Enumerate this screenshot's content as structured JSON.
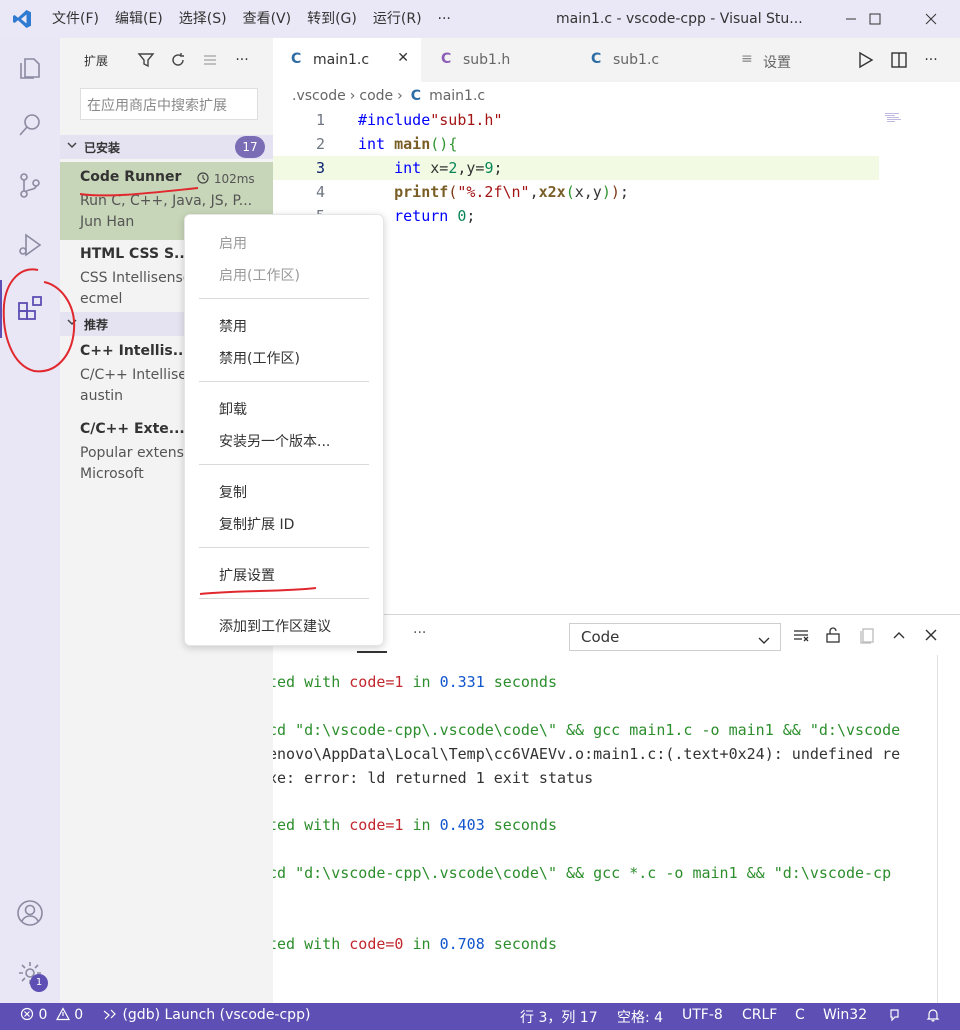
{
  "titlebar": {
    "menus": [
      "文件(F)",
      "编辑(E)",
      "选择(S)",
      "查看(V)",
      "转到(G)",
      "运行(R)",
      "···"
    ],
    "window_title": "main1.c - vscode-cpp - Visual Stu...",
    "accent": "#5d4fb3"
  },
  "activitybar": {
    "items": [
      "explorer-icon",
      "search-icon",
      "source-control-icon",
      "run-debug-icon",
      "extensions-icon"
    ],
    "accounts": "account-icon",
    "manage": "gear-icon",
    "manage_badge": "1"
  },
  "sidebar": {
    "title": "扩展",
    "search_placeholder": "在应用商店中搜索扩展",
    "installed": {
      "label": "已安装",
      "count": "17",
      "items": [
        {
          "name": "Code Runner",
          "time": "102ms",
          "desc": "Run C, C++, Java, JS, P...",
          "publisher": "Jun Han"
        },
        {
          "name": "HTML CSS S...",
          "desc": "CSS Intellisense",
          "publisher": "ecmel"
        }
      ]
    },
    "recommended": {
      "label": "推荐",
      "items": [
        {
          "name": "C++ Intellis...",
          "desc": "C/C++ Intellise",
          "publisher": "austin"
        },
        {
          "name": "C/C++ Exte...",
          "desc": "Popular extens",
          "publisher": "Microsoft"
        }
      ]
    }
  },
  "tabs": [
    {
      "icon": "C",
      "label": "main1.c",
      "close": "✕"
    },
    {
      "icon": "C",
      "label": "sub1.h"
    },
    {
      "icon": "C",
      "label": "sub1.c"
    },
    {
      "icon": "≡",
      "label": "设置"
    }
  ],
  "breadcrumb": {
    "parts": [
      ".vscode",
      "code",
      "main1.c"
    ],
    "sep": "›",
    "icon": "C"
  },
  "editor": {
    "lines": [
      {
        "n": "1",
        "tokens": [
          [
            "pp",
            "#include"
          ],
          [
            "str",
            "\"sub1.h\""
          ]
        ]
      },
      {
        "n": "2",
        "tokens": [
          [
            "kw",
            "int"
          ],
          [
            "",
            " "
          ],
          [
            "fn",
            "main"
          ],
          [
            "br1",
            "()"
          ],
          [
            "br1",
            "{"
          ]
        ]
      },
      {
        "n": "3",
        "tokens": [
          [
            "",
            "    "
          ],
          [
            "kw",
            "int"
          ],
          [
            "",
            " x="
          ],
          [
            "num",
            "2"
          ],
          [
            "",
            ",y="
          ],
          [
            "num",
            "9"
          ],
          [
            "",
            ";"
          ]
        ]
      },
      {
        "n": "4",
        "tokens": [
          [
            "",
            "    "
          ],
          [
            "fn",
            "printf"
          ],
          [
            "br2",
            "("
          ],
          [
            "str",
            "\"%.2f\\n\""
          ],
          [
            "",
            ","
          ],
          [
            "fn",
            "x2x"
          ],
          [
            "br1",
            "("
          ],
          [
            "",
            "x,y"
          ],
          [
            "br1",
            ")"
          ],
          [
            "br2",
            ")"
          ],
          [
            "",
            ";"
          ]
        ]
      },
      {
        "n": "5",
        "tokens": [
          [
            "",
            "    "
          ],
          [
            "kw",
            "return"
          ],
          [
            "",
            " "
          ],
          [
            "num",
            "0"
          ],
          [
            "",
            ";"
          ]
        ]
      }
    ],
    "current_line": "3"
  },
  "panel": {
    "more": "···",
    "channel": "Code",
    "output": [
      {
        "parts": [
          [
            "g",
            "ted with "
          ],
          [
            "r",
            "code=1"
          ],
          [
            "g",
            " in "
          ],
          [
            "b",
            "0.331"
          ],
          [
            "g",
            " seconds"
          ]
        ]
      },
      {
        "parts": [
          [
            "g",
            "cd \"d:\\vscode-cpp\\.vscode\\code\\\" && gcc main1.c -o main1 && \"d:\\vscode"
          ]
        ]
      },
      {
        "parts": [
          [
            "",
            "enovo\\AppData\\Local\\Temp\\cc6VAEVv.o:main1.c:(.text+0x24): undefined re"
          ]
        ]
      },
      {
        "parts": [
          [
            "",
            "xe: error: ld returned 1 exit status"
          ]
        ]
      },
      {
        "parts": [
          [
            "g",
            "ted with "
          ],
          [
            "r",
            "code=1"
          ],
          [
            "g",
            " in "
          ],
          [
            "b",
            "0.403"
          ],
          [
            "g",
            " seconds"
          ]
        ]
      },
      {
        "parts": [
          [
            "g",
            "cd \"d:\\vscode-cpp\\.vscode\\code\\\" && gcc *.c -o main1 && \"d:\\vscode-cp"
          ]
        ]
      },
      {
        "parts": [
          [
            "g",
            "ted with "
          ],
          [
            "r",
            "code=0"
          ],
          [
            "g",
            " in "
          ],
          [
            "b",
            "0.708"
          ],
          [
            "g",
            " seconds"
          ]
        ]
      }
    ]
  },
  "context_menu": {
    "items": [
      "启用",
      "启用(工作区)",
      "禁用",
      "禁用(工作区)",
      "卸载",
      "安装另一个版本...",
      "复制",
      "复制扩展 ID",
      "扩展设置",
      "添加到工作区建议"
    ]
  },
  "statusbar": {
    "errors": "0",
    "warnings": "0",
    "launch": "(gdb) Launch (vscode-cpp)",
    "position": "行 3，列 17",
    "spaces": "空格: 4",
    "encoding": "UTF-8",
    "eol": "CRLF",
    "language": "C",
    "platform": "Win32"
  }
}
